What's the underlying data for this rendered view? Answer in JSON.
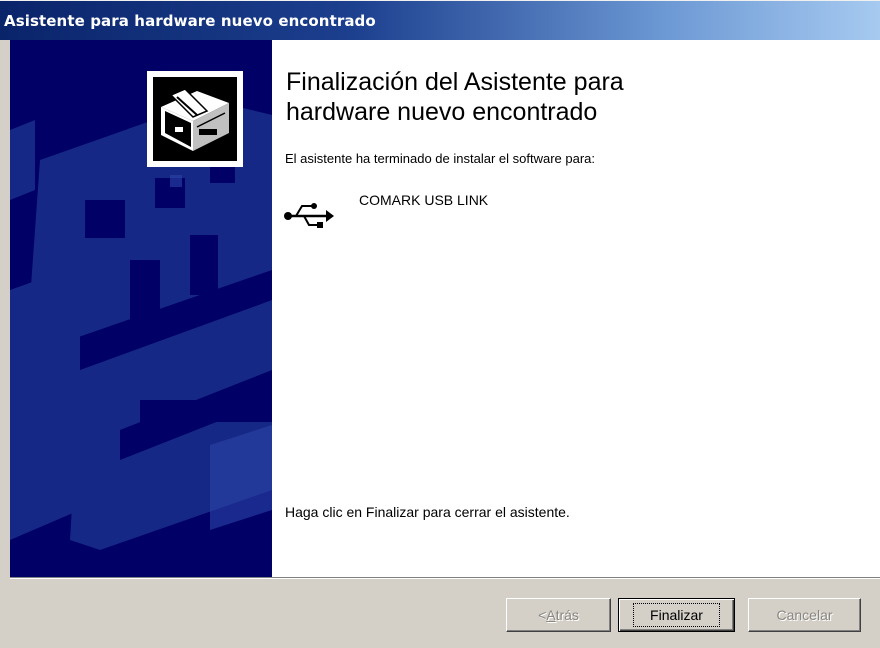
{
  "window": {
    "title": "Asistente para hardware nuevo encontrado"
  },
  "content": {
    "heading_line1": "Finalización del Asistente para",
    "heading_line2": "hardware nuevo encontrado",
    "intro": "El asistente ha terminado de instalar el software para:",
    "device": {
      "icon": "usb-icon",
      "name": "COMARK USB LINK"
    },
    "footer": "Haga clic en Finalizar para cerrar el asistente."
  },
  "buttons": {
    "back_prefix": "< ",
    "back_accesskey": "A",
    "back_rest": "trás",
    "finish": "Finalizar",
    "cancel": "Cancelar"
  },
  "colors": {
    "title_bar_start": "#0a246a",
    "title_bar_end": "#a6caf0",
    "banner": "#000066",
    "dialog_face": "#d4d0c8"
  }
}
